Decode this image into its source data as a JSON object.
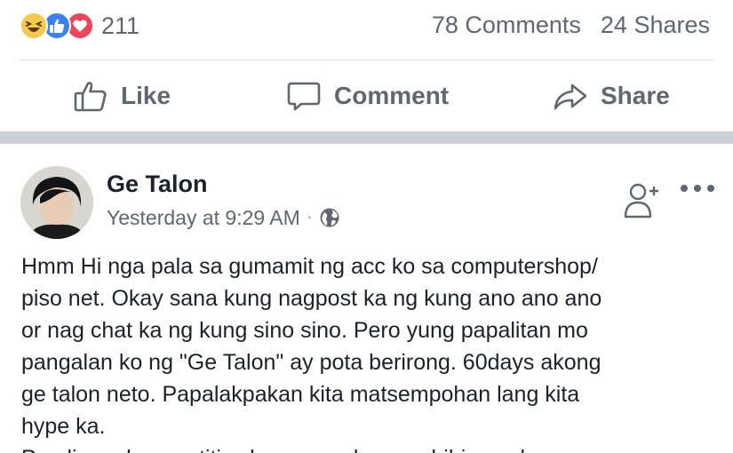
{
  "stats": {
    "reaction_icons": [
      "haha-icon",
      "like-icon",
      "love-icon"
    ],
    "reaction_count": "211",
    "comments": "78 Comments",
    "shares": "24 Shares"
  },
  "actions": {
    "like": "Like",
    "comment": "Comment",
    "share": "Share"
  },
  "post": {
    "author": "Ge Talon",
    "timestamp": "Yesterday at 9:29 AM",
    "separator": "·",
    "lines": [
      "Hmm Hi nga pala sa gumamit ng acc ko sa computershop/",
      "piso net. Okay sana kung nagpost ka ng kung ano ano ano",
      "or nag chat ka ng kung sino sino. Pero yung papalitan mo",
      "pangalan ko ng \"Ge Talon\" ay pota berirong. 60days akong",
      "ge talon neto. Papalakpakan kita matsempohan lang kita",
      "hype ka.",
      "Ps: di na ako magtitiwala suounod sa naghihiqyan ka ng"
    ]
  },
  "colors": {
    "secondary_text": "#606770",
    "primary_text": "#1d2129",
    "like_blue": "#3b82f0",
    "love_red": "#f0445c",
    "haha_yellow": "#f7c94b",
    "section_divider": "#cdd0d4"
  }
}
